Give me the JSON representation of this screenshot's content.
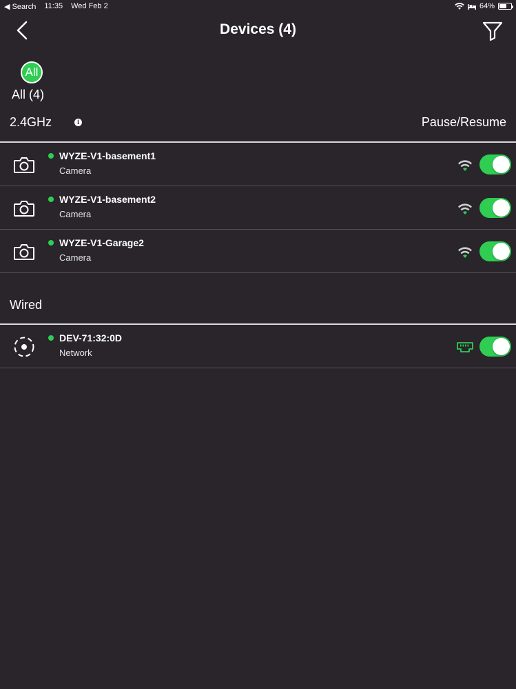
{
  "status_bar": {
    "back_app": "◀ Search",
    "time": "11:35",
    "date": "Wed Feb 2",
    "battery": "64%",
    "battery_level": 0.64
  },
  "nav": {
    "title": "Devices (4)"
  },
  "filter_chip": {
    "icon_text": "All",
    "label": "All (4)"
  },
  "sections": {
    "wireless": {
      "title": "2.4GHz",
      "action": "Pause/Resume",
      "devices": [
        {
          "name": "WYZE-V1-basement1",
          "type": "Camera",
          "connection": "wifi",
          "enabled": true
        },
        {
          "name": "WYZE-V1-basement2",
          "type": "Camera",
          "connection": "wifi",
          "enabled": true
        },
        {
          "name": "WYZE-V1-Garage2",
          "type": "Camera",
          "connection": "wifi",
          "enabled": true
        }
      ]
    },
    "wired": {
      "title": "Wired",
      "devices": [
        {
          "name": "DEV-71:32:0D",
          "type": "Network",
          "connection": "ethernet",
          "enabled": true
        }
      ]
    }
  },
  "colors": {
    "background": "#29252b",
    "accent": "#2fcd52",
    "text": "#ffffff"
  }
}
